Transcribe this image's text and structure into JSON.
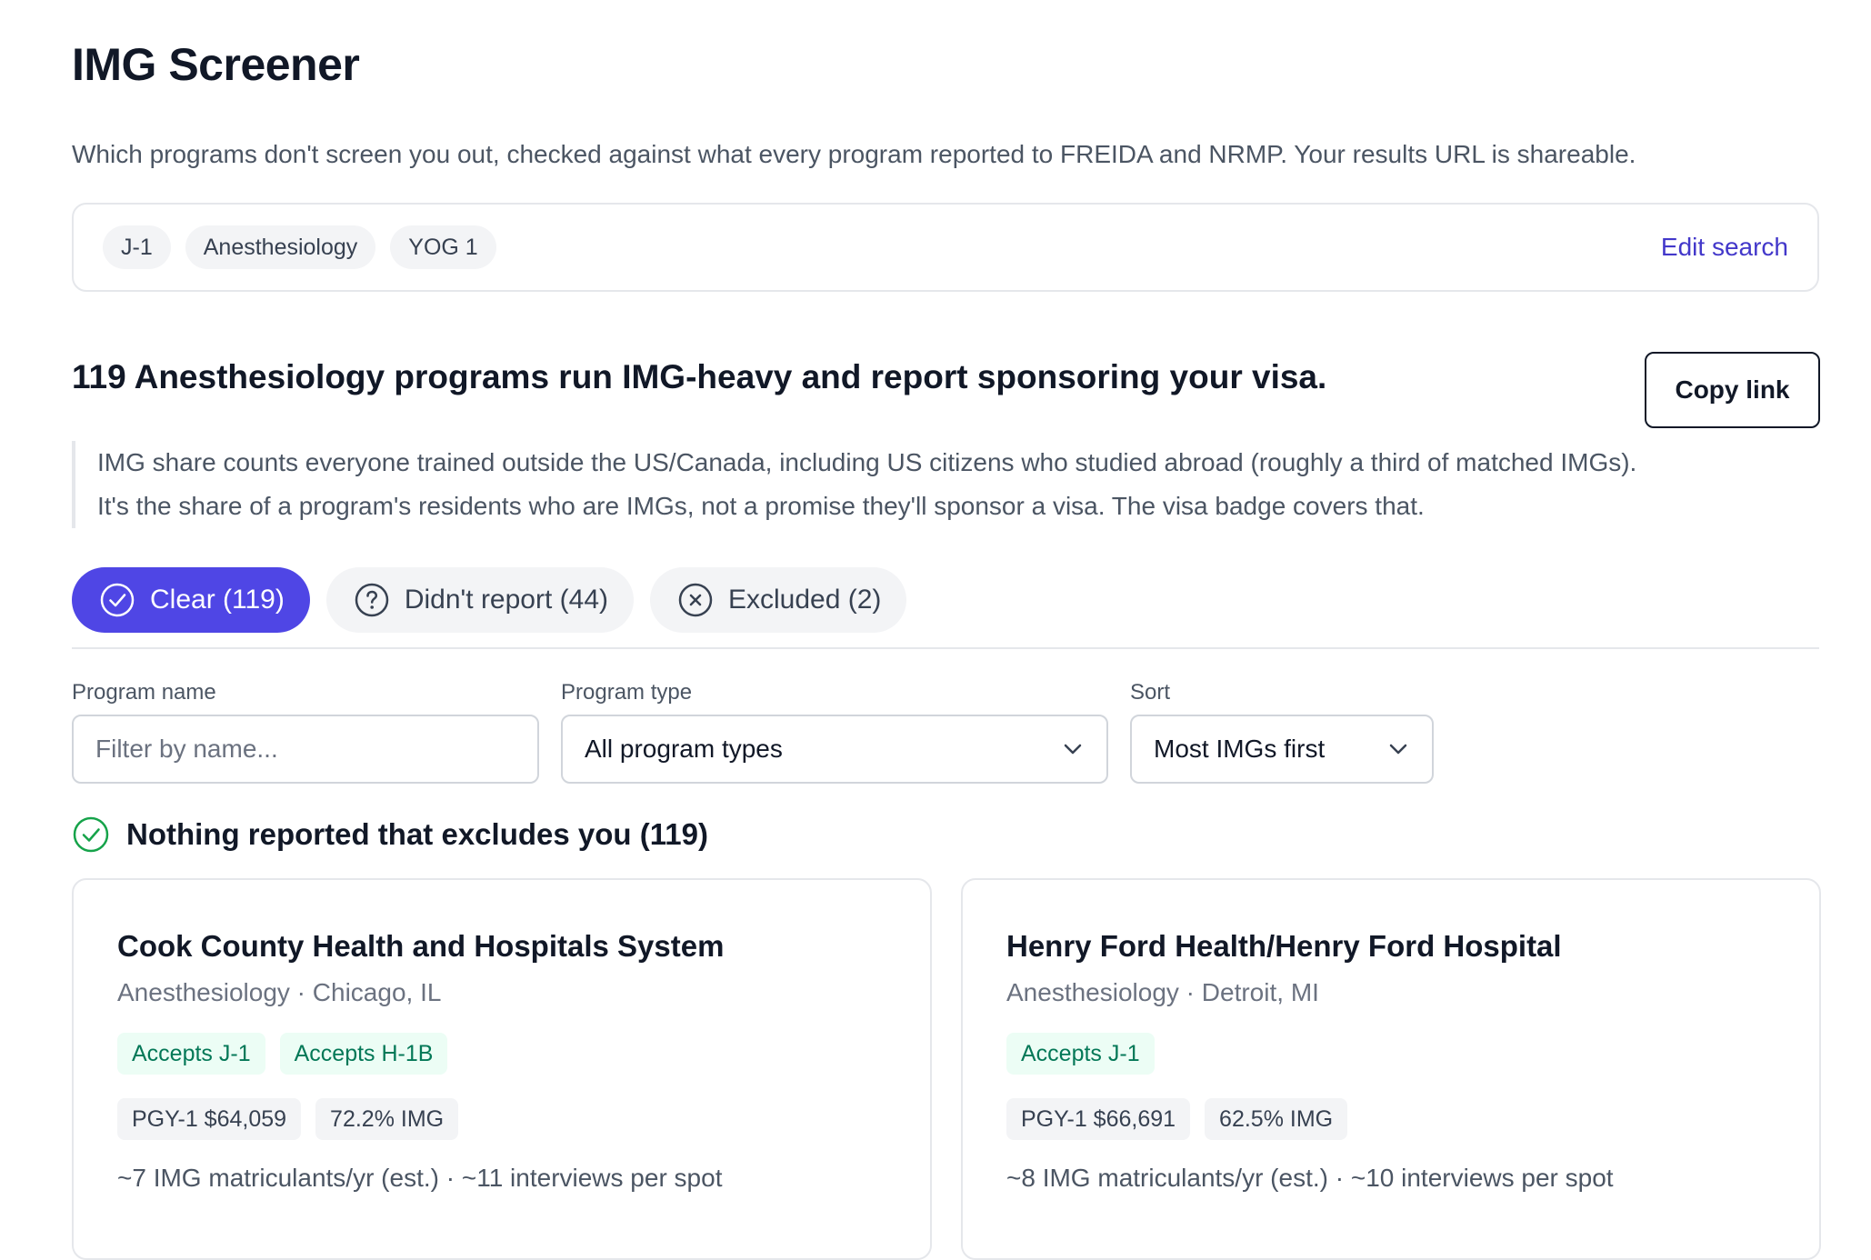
{
  "title": "IMG Screener",
  "subtitle": "Which programs don't screen you out, checked against what every program reported to FREIDA and NRMP. Your results URL is shareable.",
  "search_summary": {
    "chips": [
      "J-1",
      "Anesthesiology",
      "YOG 1"
    ],
    "edit_label": "Edit search"
  },
  "results": {
    "headline": "119 Anesthesiology programs run IMG-heavy and report sponsoring your visa.",
    "copy_label": "Copy link",
    "note_lines": [
      "IMG share counts everyone trained outside the US/Canada, including US citizens who studied abroad (roughly a third of matched IMGs).",
      "It's the share of a program's residents who are IMGs, not a promise they'll sponsor a visa. The visa badge covers that."
    ]
  },
  "tabs": [
    {
      "label": "Clear (119)",
      "icon": "check-circle-icon",
      "active": true
    },
    {
      "label": "Didn't report (44)",
      "icon": "question-circle-icon",
      "active": false
    },
    {
      "label": "Excluded (2)",
      "icon": "x-circle-icon",
      "active": false
    }
  ],
  "filters": {
    "name_label": "Program name",
    "name_placeholder": "Filter by name...",
    "type_label": "Program type",
    "type_value": "All program types",
    "sort_label": "Sort",
    "sort_value": "Most IMGs first"
  },
  "group": {
    "heading": "Nothing reported that excludes you (119)",
    "icon": "check-circle-icon",
    "icon_color": "#16a34a"
  },
  "cards": [
    {
      "name": "Cook County Health and Hospitals System",
      "meta": "Anesthesiology · Chicago, IL",
      "visas": [
        "Accepts J-1",
        "Accepts H-1B"
      ],
      "salary": "PGY-1 $64,059",
      "img_share": "72.2% IMG",
      "extra": "~7 IMG matriculants/yr (est.) · ~11 interviews per spot"
    },
    {
      "name": "Henry Ford Health/Henry Ford Hospital",
      "meta": "Anesthesiology · Detroit, MI",
      "visas": [
        "Accepts J-1"
      ],
      "salary": "PGY-1 $66,691",
      "img_share": "62.5% IMG",
      "extra": "~8 IMG matriculants/yr (est.) · ~10 interviews per spot"
    }
  ],
  "colors": {
    "accent": "#4f46e5",
    "link": "#4338ca",
    "visa_badge_bg": "#ecfdf5",
    "visa_badge_text": "#047857"
  }
}
